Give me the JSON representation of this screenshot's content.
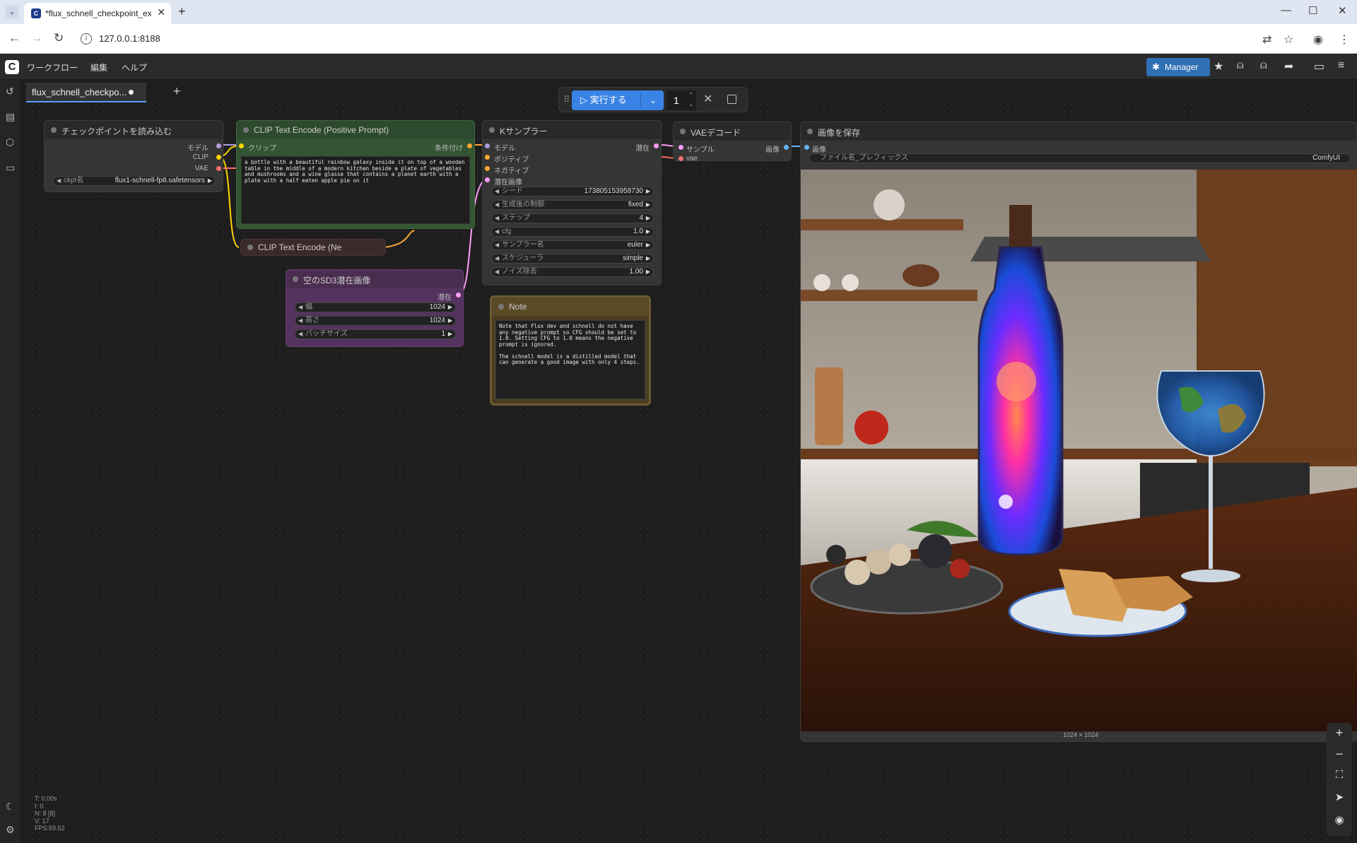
{
  "browser": {
    "tab_title": "*flux_schnell_checkpoint_example",
    "url": "127.0.0.1:8188"
  },
  "menu": {
    "workflow": "ワークフロー",
    "edit": "編集",
    "help": "ヘルプ",
    "manager": "Manager"
  },
  "workflow_tab": {
    "label": "flux_schnell_checkpo..."
  },
  "runbar": {
    "run_label": "実行する",
    "count": "1"
  },
  "nodes": {
    "checkpoint": {
      "title": "チェックポイントを読み込む",
      "out_model": "モデル",
      "out_clip": "CLIP",
      "out_vae": "VAE",
      "ckpt_label": "ckpt名",
      "ckpt_value": "flux1-schnell-fp8.safetensors"
    },
    "clip_pos": {
      "title": "CLIP Text Encode (Positive Prompt)",
      "in_clip": "クリップ",
      "out_cond": "条件付け",
      "prompt": "a bottle with a beautiful rainbow galaxy inside it on top of a wooden table in the middle of a modern kitchen beside a plate of vegetables and mushrooms and a wine glasse that contains a planet earth with a plate with a half eaten apple pie on it"
    },
    "clip_neg": {
      "title": "CLIP Text Encode (Ne"
    },
    "latent": {
      "title": "空のSD3潜在画像",
      "out_latent": "潜在",
      "width_label": "幅",
      "width_value": "1024",
      "height_label": "高さ",
      "height_value": "1024",
      "batch_label": "バッチサイズ",
      "batch_value": "1"
    },
    "ksampler": {
      "title": "Kサンプラー",
      "in_model": "モデル",
      "in_positive": "ポジティブ",
      "in_negative": "ネガティブ",
      "in_latent": "潜在画像",
      "out_latent": "潜在",
      "seed_label": "シード",
      "seed_value": "173805153958730",
      "control_label": "生成後の制御",
      "control_value": "fixed",
      "steps_label": "ステップ",
      "steps_value": "4",
      "cfg_label": "cfg",
      "cfg_value": "1.0",
      "sampler_label": "サンプラー名",
      "sampler_value": "euler",
      "scheduler_label": "スケジューラ",
      "scheduler_value": "simple",
      "denoise_label": "ノイズ除去",
      "denoise_value": "1.00"
    },
    "note": {
      "title": "Note",
      "text": "Note that Flux dev and schnell do not have any negative prompt so CFG should be set to 1.0. Setting CFG to 1.0 means the negative prompt is ignored.\n\nThe schnell model is a distilled model that can generate a good image with only 4 steps."
    },
    "vae": {
      "title": "VAEデコード",
      "in_samples": "サンプル",
      "in_vae": "vae",
      "out_image": "画像"
    },
    "save": {
      "title": "画像を保存",
      "in_images": "画像",
      "prefix_label": "ファイル名_プレフィックス",
      "prefix_value": "ComfyUI",
      "dims": "1024 × 1024"
    }
  },
  "stats": {
    "t": "T: 0.00s",
    "i": "I: 0",
    "n": "N: 8 [8]",
    "v": "V: 17",
    "fps": "FPS:59.52"
  },
  "colors": {
    "accent": "#3a83e6",
    "positive_node": "#2e4a2e",
    "negative_node": "#3a2a2a",
    "latent_node": "#4a2e50",
    "note_node": "#5a4a28",
    "link_clip": "#ffd500",
    "link_model": "#b39ddb",
    "link_cond": "#ffa931",
    "link_latent": "#ff9cf9",
    "link_vae": "#ff6e6e",
    "link_image": "#64b5f6"
  }
}
